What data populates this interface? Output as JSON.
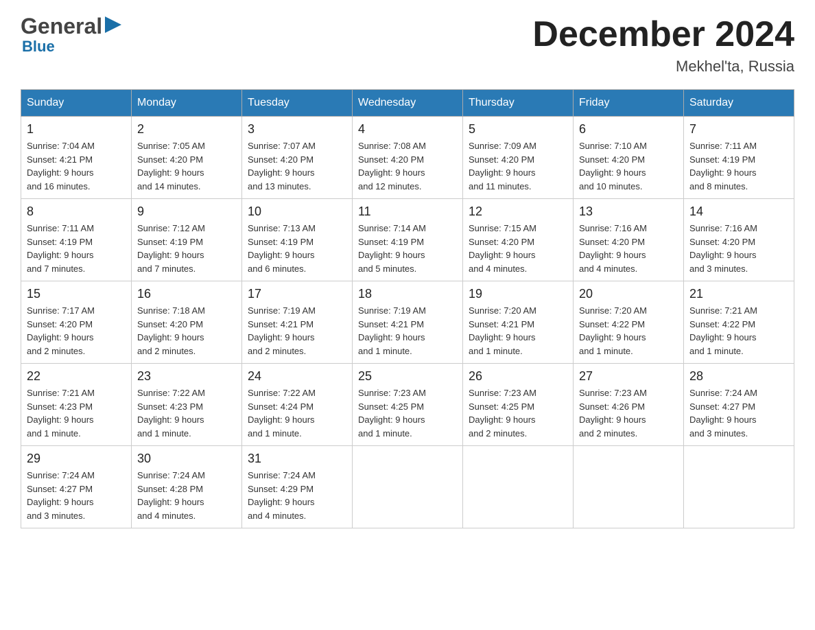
{
  "header": {
    "logo_general": "General",
    "logo_blue": "Blue",
    "title": "December 2024",
    "location": "Mekhel'ta, Russia"
  },
  "days_of_week": [
    "Sunday",
    "Monday",
    "Tuesday",
    "Wednesday",
    "Thursday",
    "Friday",
    "Saturday"
  ],
  "weeks": [
    [
      {
        "day": "1",
        "sunrise": "7:04 AM",
        "sunset": "4:21 PM",
        "daylight": "9 hours and 16 minutes."
      },
      {
        "day": "2",
        "sunrise": "7:05 AM",
        "sunset": "4:20 PM",
        "daylight": "9 hours and 14 minutes."
      },
      {
        "day": "3",
        "sunrise": "7:07 AM",
        "sunset": "4:20 PM",
        "daylight": "9 hours and 13 minutes."
      },
      {
        "day": "4",
        "sunrise": "7:08 AM",
        "sunset": "4:20 PM",
        "daylight": "9 hours and 12 minutes."
      },
      {
        "day": "5",
        "sunrise": "7:09 AM",
        "sunset": "4:20 PM",
        "daylight": "9 hours and 11 minutes."
      },
      {
        "day": "6",
        "sunrise": "7:10 AM",
        "sunset": "4:20 PM",
        "daylight": "9 hours and 10 minutes."
      },
      {
        "day": "7",
        "sunrise": "7:11 AM",
        "sunset": "4:19 PM",
        "daylight": "9 hours and 8 minutes."
      }
    ],
    [
      {
        "day": "8",
        "sunrise": "7:11 AM",
        "sunset": "4:19 PM",
        "daylight": "9 hours and 7 minutes."
      },
      {
        "day": "9",
        "sunrise": "7:12 AM",
        "sunset": "4:19 PM",
        "daylight": "9 hours and 7 minutes."
      },
      {
        "day": "10",
        "sunrise": "7:13 AM",
        "sunset": "4:19 PM",
        "daylight": "9 hours and 6 minutes."
      },
      {
        "day": "11",
        "sunrise": "7:14 AM",
        "sunset": "4:19 PM",
        "daylight": "9 hours and 5 minutes."
      },
      {
        "day": "12",
        "sunrise": "7:15 AM",
        "sunset": "4:20 PM",
        "daylight": "9 hours and 4 minutes."
      },
      {
        "day": "13",
        "sunrise": "7:16 AM",
        "sunset": "4:20 PM",
        "daylight": "9 hours and 4 minutes."
      },
      {
        "day": "14",
        "sunrise": "7:16 AM",
        "sunset": "4:20 PM",
        "daylight": "9 hours and 3 minutes."
      }
    ],
    [
      {
        "day": "15",
        "sunrise": "7:17 AM",
        "sunset": "4:20 PM",
        "daylight": "9 hours and 2 minutes."
      },
      {
        "day": "16",
        "sunrise": "7:18 AM",
        "sunset": "4:20 PM",
        "daylight": "9 hours and 2 minutes."
      },
      {
        "day": "17",
        "sunrise": "7:19 AM",
        "sunset": "4:21 PM",
        "daylight": "9 hours and 2 minutes."
      },
      {
        "day": "18",
        "sunrise": "7:19 AM",
        "sunset": "4:21 PM",
        "daylight": "9 hours and 1 minute."
      },
      {
        "day": "19",
        "sunrise": "7:20 AM",
        "sunset": "4:21 PM",
        "daylight": "9 hours and 1 minute."
      },
      {
        "day": "20",
        "sunrise": "7:20 AM",
        "sunset": "4:22 PM",
        "daylight": "9 hours and 1 minute."
      },
      {
        "day": "21",
        "sunrise": "7:21 AM",
        "sunset": "4:22 PM",
        "daylight": "9 hours and 1 minute."
      }
    ],
    [
      {
        "day": "22",
        "sunrise": "7:21 AM",
        "sunset": "4:23 PM",
        "daylight": "9 hours and 1 minute."
      },
      {
        "day": "23",
        "sunrise": "7:22 AM",
        "sunset": "4:23 PM",
        "daylight": "9 hours and 1 minute."
      },
      {
        "day": "24",
        "sunrise": "7:22 AM",
        "sunset": "4:24 PM",
        "daylight": "9 hours and 1 minute."
      },
      {
        "day": "25",
        "sunrise": "7:23 AM",
        "sunset": "4:25 PM",
        "daylight": "9 hours and 1 minute."
      },
      {
        "day": "26",
        "sunrise": "7:23 AM",
        "sunset": "4:25 PM",
        "daylight": "9 hours and 2 minutes."
      },
      {
        "day": "27",
        "sunrise": "7:23 AM",
        "sunset": "4:26 PM",
        "daylight": "9 hours and 2 minutes."
      },
      {
        "day": "28",
        "sunrise": "7:24 AM",
        "sunset": "4:27 PM",
        "daylight": "9 hours and 3 minutes."
      }
    ],
    [
      {
        "day": "29",
        "sunrise": "7:24 AM",
        "sunset": "4:27 PM",
        "daylight": "9 hours and 3 minutes."
      },
      {
        "day": "30",
        "sunrise": "7:24 AM",
        "sunset": "4:28 PM",
        "daylight": "9 hours and 4 minutes."
      },
      {
        "day": "31",
        "sunrise": "7:24 AM",
        "sunset": "4:29 PM",
        "daylight": "9 hours and 4 minutes."
      },
      null,
      null,
      null,
      null
    ]
  ],
  "labels": {
    "sunrise": "Sunrise:",
    "sunset": "Sunset:",
    "daylight": "Daylight:"
  }
}
